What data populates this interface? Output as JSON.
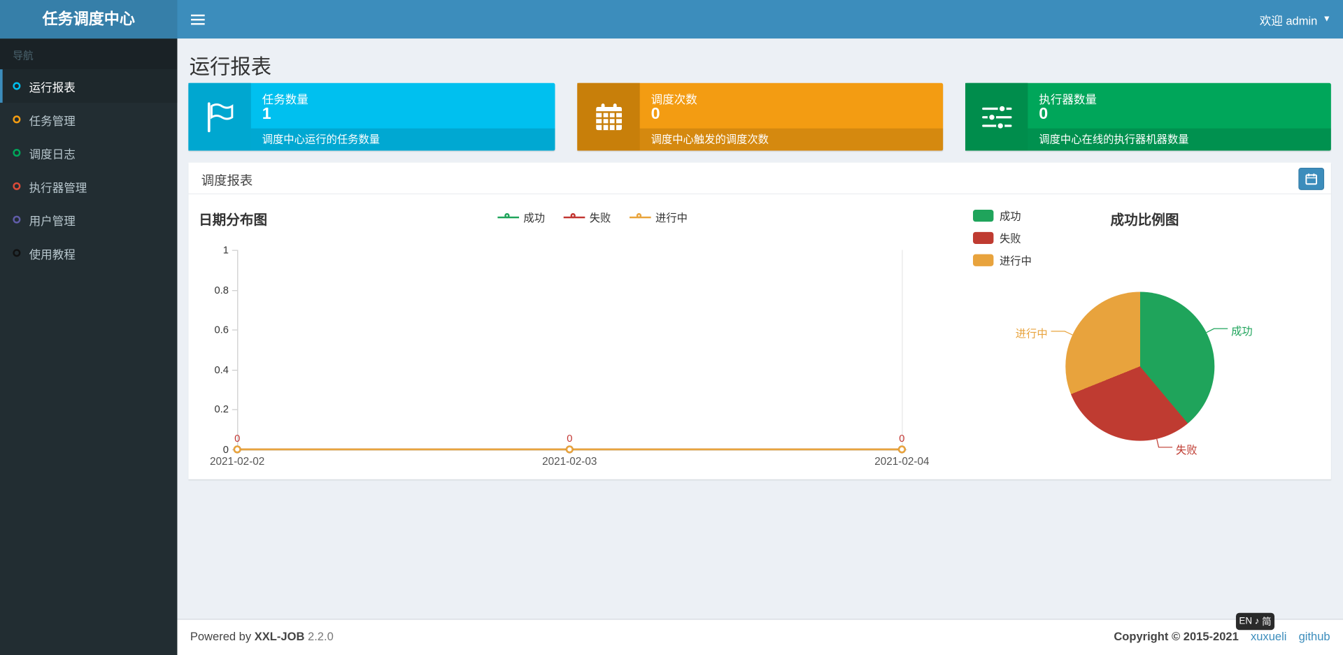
{
  "navbar": {
    "brand": "任务调度中心",
    "welcome": "欢迎 admin"
  },
  "sidebar": {
    "section_label": "导航",
    "items": [
      {
        "label": "运行报表",
        "icon_color": "#00c0ef",
        "active": true
      },
      {
        "label": "任务管理",
        "icon_color": "#f39c12",
        "active": false
      },
      {
        "label": "调度日志",
        "icon_color": "#00a65a",
        "active": false
      },
      {
        "label": "执行器管理",
        "icon_color": "#dd4b39",
        "active": false
      },
      {
        "label": "用户管理",
        "icon_color": "#605ca8",
        "active": false
      },
      {
        "label": "使用教程",
        "icon_color": "#111111",
        "active": false
      }
    ]
  },
  "page": {
    "title": "运行报表"
  },
  "stat_boxes": [
    {
      "title": "任务数量",
      "value": "1",
      "desc": "调度中心运行的任务数量",
      "color": "#00c0ef",
      "icon_bg": "#00a7d0",
      "icon": "flag-icon"
    },
    {
      "title": "调度次数",
      "value": "0",
      "desc": "调度中心触发的调度次数",
      "color": "#f39c12",
      "icon_bg": "#c87f0a",
      "icon": "calendar-icon"
    },
    {
      "title": "执行器数量",
      "value": "0",
      "desc": "调度中心在线的执行器机器数量",
      "color": "#00a65a",
      "icon_bg": "#008d4c",
      "icon": "sliders-icon"
    }
  ],
  "report_panel": {
    "title": "调度报表"
  },
  "chart_data": [
    {
      "type": "line",
      "title": "日期分布图",
      "x": [
        "2021-02-02",
        "2021-02-03",
        "2021-02-04"
      ],
      "series": [
        {
          "name": "成功",
          "color": "#1fa45b",
          "values": [
            0,
            0,
            0
          ]
        },
        {
          "name": "失败",
          "color": "#c23531",
          "values": [
            0,
            0,
            0
          ]
        },
        {
          "name": "进行中",
          "color": "#e9a43c",
          "values": [
            0,
            0,
            0
          ]
        }
      ],
      "ylim": [
        0,
        1
      ],
      "yticks": [
        0,
        0.2,
        0.4,
        0.6,
        0.8,
        1
      ],
      "point_labels": {
        "values": [
          "0",
          "0",
          "0"
        ],
        "color": "#c23531"
      },
      "legend_position": "top-center",
      "grid": false
    },
    {
      "type": "pie",
      "title": "成功比例图",
      "slices": [
        {
          "name": "成功",
          "value": 38.9,
          "color": "#1fa45b"
        },
        {
          "name": "失败",
          "value": 30.0,
          "color": "#bf3b31"
        },
        {
          "name": "进行中",
          "value": 31.1,
          "color": "#e8a33d"
        }
      ],
      "legend_position": "top-left"
    }
  ],
  "footer": {
    "powered_by": "Powered by",
    "brand": "XXL-JOB",
    "version": "2.2.0",
    "copyright": "Copyright © 2015-2021",
    "link_author": "xuxueli",
    "link_github": "github"
  },
  "ime_badge": {
    "left": "EN",
    "icon": "♪",
    "right": "简"
  }
}
